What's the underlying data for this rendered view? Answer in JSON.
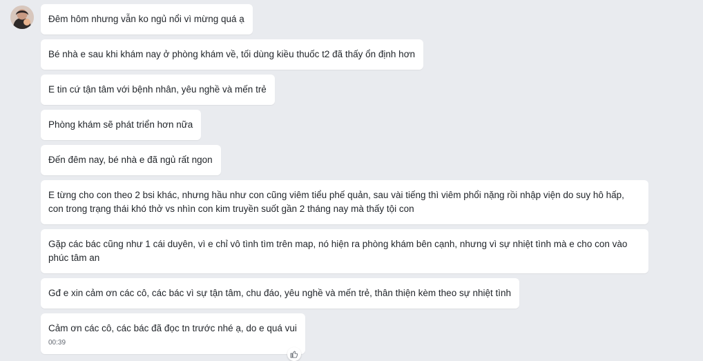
{
  "messages": [
    {
      "text": "Đêm hôm nhưng vẫn ko ngủ nổi vì mừng quá ạ"
    },
    {
      "text": "Bé nhà e sau khi khám nay ở phòng khám về, tối dùng kiều thuốc t2 đã thấy ổn định hơn"
    },
    {
      "text": "E tin cứ tận tâm với bệnh nhân, yêu nghề và mến trẻ"
    },
    {
      "text": "Phòng khám sẽ phát triển hơn nữa"
    },
    {
      "text": "Đến đêm nay, bé nhà e đã ngủ rất ngon"
    },
    {
      "text": "E từng cho con theo 2 bsi khác, nhưng hầu như con cũng viêm tiểu phế quản, sau vài tiếng thì viêm phổi nặng rồi nhập viện do suy hô hấp, con trong trạng thái khó thở vs nhìn con kim truyền suốt gần 2 tháng nay mà thấy tội con"
    },
    {
      "text": "Gặp các bác cũng như 1 cái duyên, vì e chỉ vô tình tìm trên map, nó hiện ra phòng khám bên cạnh, nhưng vì sự nhiệt tình mà e cho con vào phúc tâm an"
    },
    {
      "text": "Gđ e xin cảm ơn các cô, các bác vì sự tận tâm, chu đáo, yêu nghề và mến trẻ, thân thiện kèm theo sự nhiệt tình"
    },
    {
      "text": "Cảm ơn các cô, các bác đã đọc tn trước nhé ạ, do e quá vui",
      "time": "00:39"
    }
  ],
  "icons": {
    "avatar": "user-avatar",
    "reaction": "thumbs-up-icon"
  },
  "colors": {
    "background": "#e9ebef",
    "bubble": "#ffffff",
    "text": "#1f2328",
    "time": "#616770"
  }
}
